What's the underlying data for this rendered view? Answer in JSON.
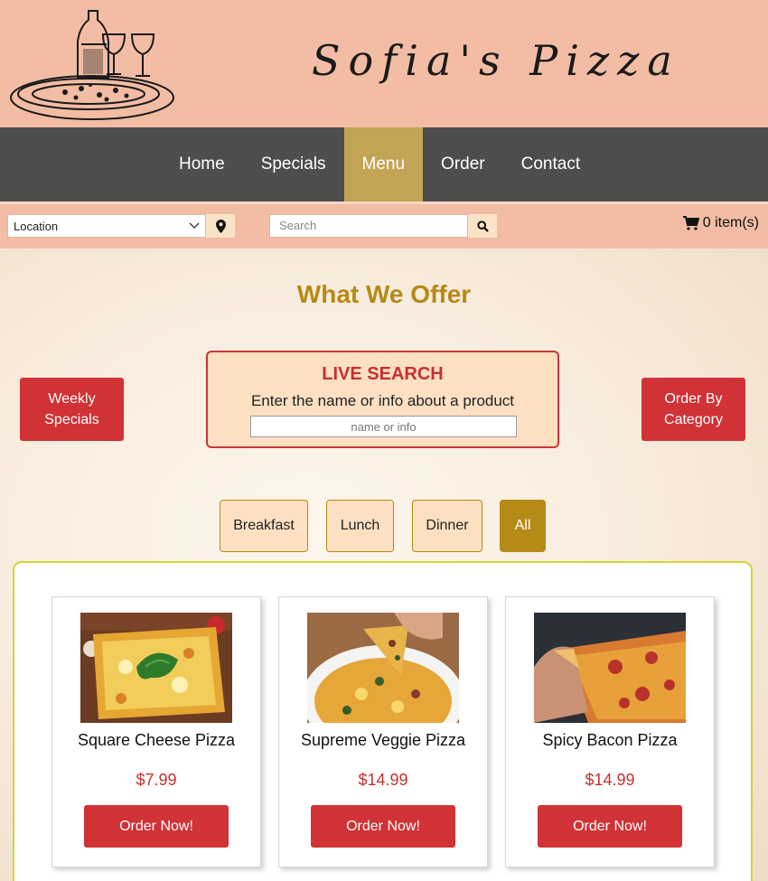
{
  "header": {
    "brand": "Sofia's Pizza",
    "logo_icon": "pizza-wine-sketch-icon"
  },
  "nav": {
    "items": [
      {
        "label": "Home",
        "active": false
      },
      {
        "label": "Specials",
        "active": false
      },
      {
        "label": "Menu",
        "active": true
      },
      {
        "label": "Order",
        "active": false
      },
      {
        "label": "Contact",
        "active": false
      }
    ]
  },
  "toolbar": {
    "location_value": "Location",
    "search_placeholder": "Search",
    "cart_text": "0 item(s)"
  },
  "main": {
    "title": "What We Offer",
    "weekly_specials": "Weekly Specials",
    "order_by_category": "Order By Category",
    "live_search": {
      "title": "LIVE SEARCH",
      "subtitle": "Enter the name or info about a product",
      "placeholder": "name or info"
    },
    "filters": [
      {
        "label": "Breakfast",
        "active": false
      },
      {
        "label": "Lunch",
        "active": false
      },
      {
        "label": "Dinner",
        "active": false
      },
      {
        "label": "All",
        "active": true
      }
    ],
    "products": [
      {
        "name": "Square Cheese Pizza",
        "price": "$7.99",
        "button": "Order Now!"
      },
      {
        "name": "Supreme Veggie Pizza",
        "price": "$14.99",
        "button": "Order Now!"
      },
      {
        "name": "Spicy Bacon Pizza",
        "price": "$14.99",
        "button": "Order Now!"
      }
    ]
  },
  "colors": {
    "header_bg": "#f2bda4",
    "nav_bg": "#4d4d4d",
    "nav_active": "#c4a456",
    "accent_red": "#d03236",
    "gold": "#b58a16",
    "panel_border": "#cfd736"
  }
}
